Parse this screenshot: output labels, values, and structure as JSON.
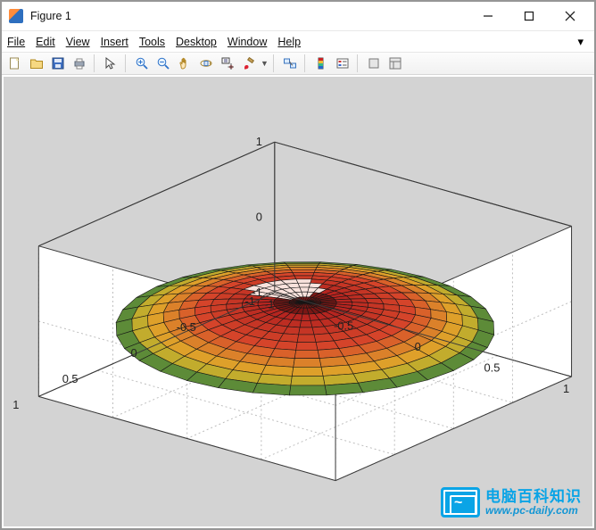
{
  "window": {
    "title": "Figure 1"
  },
  "menu": {
    "file": "File",
    "edit": "Edit",
    "view": "View",
    "insert": "Insert",
    "tools": "Tools",
    "desktop": "Desktop",
    "window": "Window",
    "help": "Help",
    "tail_glyph": "▾"
  },
  "toolbar": {
    "new": "new-figure",
    "open": "open",
    "save": "save",
    "print": "print",
    "pointer": "edit-pointer",
    "zoom_in": "zoom-in",
    "zoom_out": "zoom-out",
    "pan": "pan",
    "rotate3d": "rotate-3d",
    "datacursor": "data-cursor",
    "brush": "brush",
    "link": "link-plots",
    "colorbar": "insert-colorbar",
    "legend": "insert-legend",
    "hideplot": "hide-plot-tools",
    "showplot": "show-plot-tools"
  },
  "watermark": {
    "text_cn": "电脑百科知识",
    "text_url": "www.pc-daily.com"
  },
  "chart_data": {
    "type": "other",
    "description": "3D polar surface (disc shaped, colored by radius/height) rendered with MATLAB surf in a cylindrical wireframe",
    "x_ticks": [
      -1,
      -0.5,
      0,
      0.5,
      1
    ],
    "y_ticks": [
      -1,
      -0.5,
      0,
      0.5,
      1
    ],
    "z_ticks": [
      -1,
      0,
      1
    ],
    "xlim": [
      -1,
      1
    ],
    "ylim": [
      -1,
      1
    ],
    "zlim": [
      -1,
      1
    ],
    "surface": {
      "radial_divisions": 12,
      "angular_divisions": 32,
      "z_at_r0": 1.0,
      "z_at_r1": -1.0,
      "colormap_low": "#1a6f3b",
      "colormap_mid": "#e0b62a",
      "colormap_high": "#b0201e",
      "colormap_highlight": "#f9e2dc"
    }
  }
}
